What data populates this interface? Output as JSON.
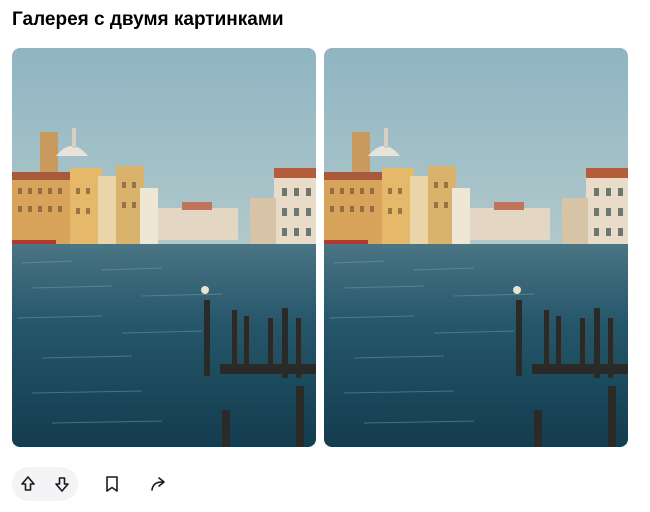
{
  "post": {
    "title": "Галерея с двумя картинками"
  },
  "gallery": {
    "images": [
      {
        "name": "venice-canal-photo-1"
      },
      {
        "name": "venice-canal-photo-2"
      }
    ]
  },
  "actions": {
    "upvote_icon": "arrow-up-icon",
    "downvote_icon": "arrow-down-icon",
    "bookmark_icon": "bookmark-icon",
    "share_icon": "share-arrow-icon"
  },
  "colors": {
    "sky": "#a9c7cf",
    "water": "#1f4c5f",
    "vote_bg": "#f4f4f6",
    "icon": "#1a1a1a"
  }
}
